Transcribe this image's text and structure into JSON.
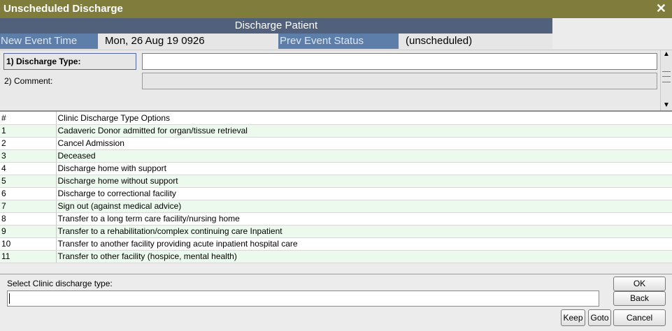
{
  "window": {
    "title": "Unscheduled Discharge",
    "close_glyph": "✕"
  },
  "header": {
    "title": "Discharge Patient"
  },
  "info": {
    "new_event_time_label": "New Event Time",
    "new_event_time_value": "Mon, 26 Aug 19  0926",
    "prev_event_status_label": "Prev Event Status",
    "prev_event_status_value": "(unscheduled)"
  },
  "form": {
    "field1_label": "1)  Discharge Type:",
    "field1_value": "",
    "field2_label": "2)  Comment:",
    "field2_value": ""
  },
  "table": {
    "columns": [
      "#",
      "Clinic Discharge Type Options"
    ],
    "rows": [
      [
        "1",
        "Cadaveric Donor admitted for organ/tissue retrieval"
      ],
      [
        "2",
        "Cancel Admission"
      ],
      [
        "3",
        "Deceased"
      ],
      [
        "4",
        "Discharge home with support"
      ],
      [
        "5",
        "Discharge home without support"
      ],
      [
        "6",
        "Discharge to correctional facility"
      ],
      [
        "7",
        "Sign out (against medical advice)"
      ],
      [
        "8",
        "Transfer to a long term care facility/nursing home"
      ],
      [
        "9",
        "Transfer to a rehabilitation/complex continuing care Inpatient"
      ],
      [
        "10",
        "Transfer to another facility providing acute inpatient hospital care"
      ],
      [
        "11",
        "Transfer to other facility (hospice, mental health)"
      ]
    ]
  },
  "bottom": {
    "prompt": "Select Clinic discharge type:",
    "input_value": "",
    "ok_label": "OK",
    "back_label": "Back",
    "keep_label": "Keep",
    "goto_label": "Goto",
    "cancel_label": "Cancel"
  },
  "colors": {
    "titlebar": "#807c3c",
    "header_band": "#51607b",
    "label_band": "#5e7eaa",
    "row_stripe": "#ecfaee"
  },
  "icons": {
    "scroll_up": "chevron-up-icon",
    "scroll_down": "chevron-down-icon",
    "close": "close-icon"
  }
}
